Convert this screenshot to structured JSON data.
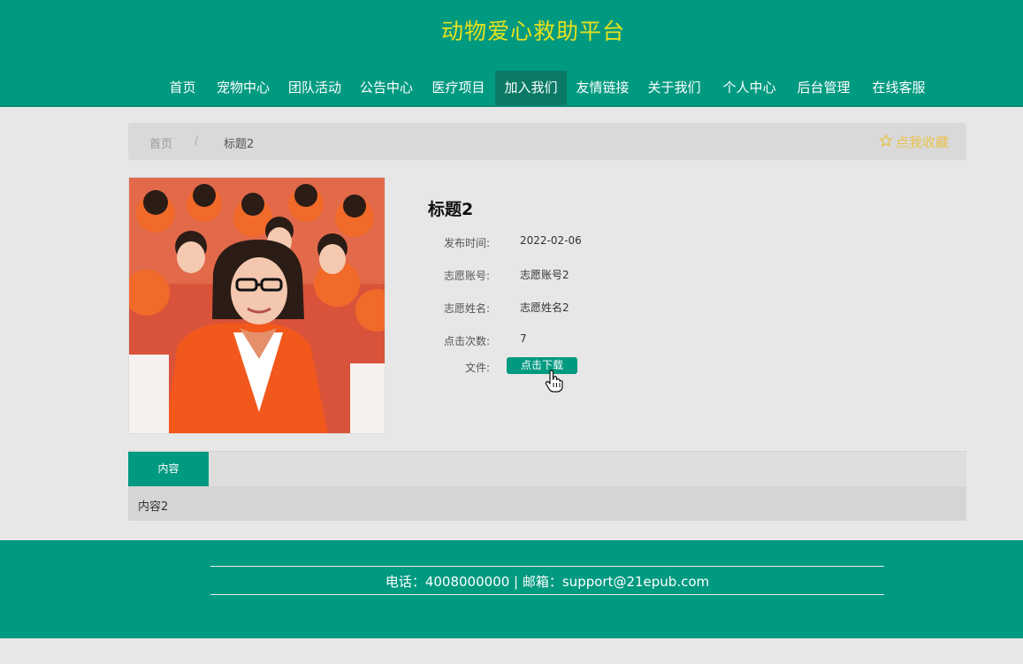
{
  "site": {
    "title": "动物爱心救助平台"
  },
  "nav": [
    {
      "label": "首页"
    },
    {
      "label": "宠物中心"
    },
    {
      "label": "团队活动"
    },
    {
      "label": "公告中心"
    },
    {
      "label": "医疗项目"
    },
    {
      "label": "加入我们",
      "active": true
    },
    {
      "label": "友情链接"
    },
    {
      "label": "关于我们"
    },
    {
      "label": "个人中心"
    },
    {
      "label": "后台管理"
    },
    {
      "label": "在线客服"
    }
  ],
  "breadcrumb": {
    "home": "首页",
    "separator": "/",
    "current": "标题2",
    "favorite_label": "点我收藏"
  },
  "detail": {
    "title": "标题2",
    "fields": [
      {
        "label": "发布时间:",
        "value": "2022-02-06"
      },
      {
        "label": "志愿账号:",
        "value": "志愿账号2"
      },
      {
        "label": "志愿姓名:",
        "value": "志愿姓名2"
      },
      {
        "label": "点击次数:",
        "value": "7"
      }
    ],
    "file_label": "文件:",
    "download_label": "点击下载"
  },
  "tabs": {
    "active_label": "内容",
    "content": "内容2"
  },
  "footer": {
    "contact": "电话：4008000000 | 邮箱：support@21epub.com"
  },
  "colors": {
    "brand": "#009a80",
    "title_yellow": "#e6e21d",
    "favorite": "#e9c24b"
  },
  "icons": {
    "favorite": "star-outline-icon",
    "cursor": "hand-pointer-icon"
  }
}
